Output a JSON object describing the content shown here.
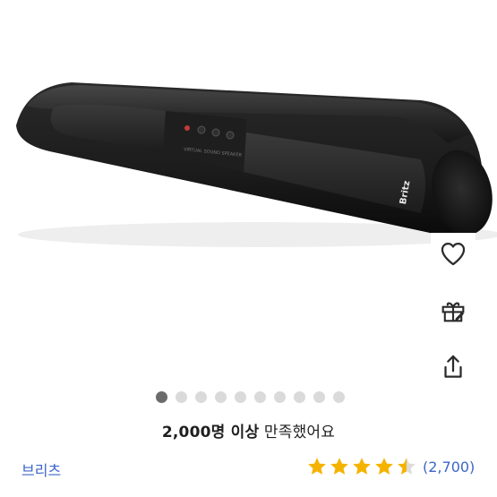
{
  "product": {
    "image_label": "Britz",
    "panel_text": "VIRTUAL SOUND SPEAKER"
  },
  "actions": {
    "wishlist_icon": "heart-outline-icon",
    "gift_icon": "gift-icon",
    "share_icon": "share-icon"
  },
  "carousel": {
    "total_slides": 10,
    "active_index": 0
  },
  "satisfaction": {
    "count_text": "2,000명 이상",
    "suffix_text": " 만족했어요"
  },
  "brand": {
    "name": "브리츠"
  },
  "rating": {
    "stars_value": 4.5,
    "max": 5,
    "review_count": "(2,700)",
    "star_color": "#f5b301",
    "star_empty_color": "#dcdcdc"
  },
  "colors": {
    "link": "#3c66c9",
    "dot_active": "#6b6b6b",
    "dot_inactive": "#dadada"
  }
}
